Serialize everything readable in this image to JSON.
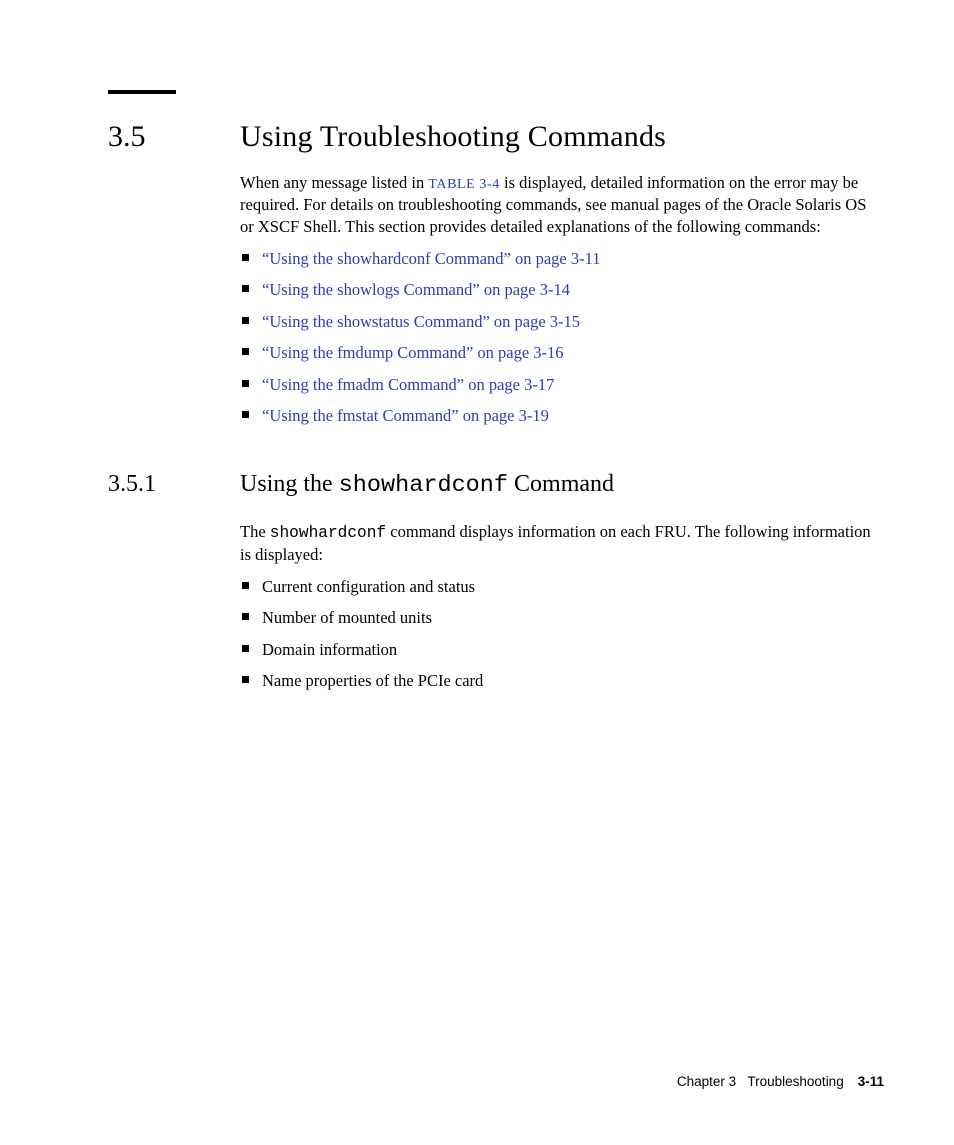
{
  "section": {
    "num": "3.5",
    "title": "Using Troubleshooting Commands",
    "intro_a": "When any message listed in ",
    "intro_link": "TABLE 3-4",
    "intro_b": " is displayed, detailed information on the error may be required. For details on troubleshooting commands, see manual pages of the Oracle Solaris OS or XSCF Shell. This section provides detailed explanations of the following commands:",
    "links": [
      "“Using the showhardconf Command” on page 3-11",
      "“Using the showlogs Command” on page 3-14",
      "“Using the showstatus Command” on page 3-15",
      "“Using the fmdump Command” on page 3-16",
      "“Using the fmadm Command” on page 3-17",
      "“Using the fmstat Command” on page 3-19"
    ]
  },
  "subsection": {
    "num": "3.5.1",
    "title_a": "Using the ",
    "title_code": "showhardconf",
    "title_b": " Command",
    "para_a": "The ",
    "para_code": "showhardconf",
    "para_b": " command displays information on each FRU. The following information is displayed:",
    "items": [
      "Current configuration and status",
      "Number of mounted units",
      "Domain information",
      "Name properties of the PCIe card"
    ]
  },
  "footer": {
    "chapter": "Chapter 3",
    "title": "Troubleshooting",
    "page": "3-11"
  }
}
